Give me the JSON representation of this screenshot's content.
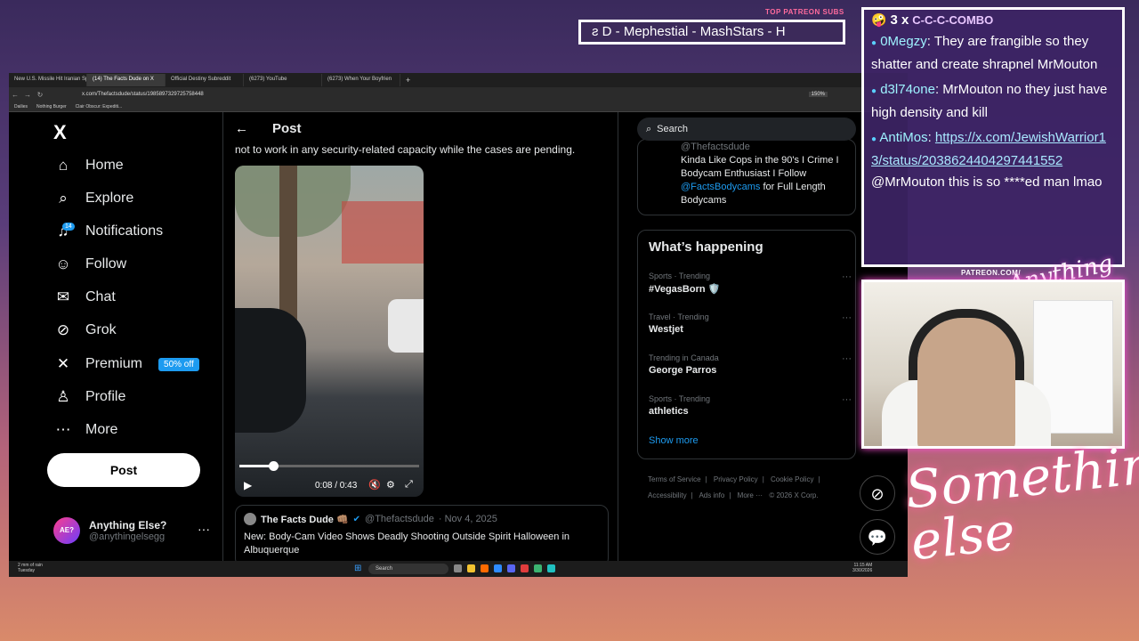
{
  "overlay": {
    "patreon_subs_title": "TOP PATREON SUBS",
    "ticker_text": "ƨ D - Mephestial - MashStars - H",
    "patreon_url": "PATREON.COM/",
    "logo_text": "Anything Else?",
    "signature_text": "Something else"
  },
  "browser": {
    "tabs": [
      {
        "label": "New U.S. Missile Hit Iranian Sp",
        "active": false
      },
      {
        "label": "(14) The Facts Dude on X",
        "active": true
      },
      {
        "label": "Official Destiny Subreddit",
        "active": false
      },
      {
        "label": "(6273) YouTube",
        "active": false
      },
      {
        "label": "(6273) When Your Boyfrien",
        "active": false
      }
    ],
    "url": "x.com/Thefactsdude/status/1985897329725758448",
    "zoom": "150%",
    "bookmarks": [
      "Dailies",
      "Nothing Burger",
      "Clair Obscur: Expediti..."
    ]
  },
  "x": {
    "logo": "X",
    "nav": [
      {
        "label": "Home",
        "icon": "home-icon"
      },
      {
        "label": "Explore",
        "icon": "search-icon"
      },
      {
        "label": "Notifications",
        "icon": "bell-icon",
        "badge": "14"
      },
      {
        "label": "Follow",
        "icon": "person-add-icon"
      },
      {
        "label": "Chat",
        "icon": "mail-icon"
      },
      {
        "label": "Grok",
        "icon": "grok-icon"
      },
      {
        "label": "Premium",
        "icon": "x-icon",
        "pill": "50% off"
      },
      {
        "label": "Profile",
        "icon": "person-icon"
      },
      {
        "label": "More",
        "icon": "more-circle-icon"
      }
    ],
    "post_button": "Post",
    "account": {
      "avatar_text": "AE?",
      "name": "Anything Else?",
      "handle": "@anythingelsegg"
    },
    "post_header": "Post",
    "body_text": "not to work in any security-related capacity while the cases are pending.",
    "video": {
      "time": "0:08 / 0:43",
      "progress": 0.186
    },
    "quote": {
      "name": "The Facts Dude 👊🏽",
      "handle": "@Thefactsdude",
      "date": "· Nov 4, 2025",
      "text": "New: Body-Cam Video Shows Deadly Shooting Outside Spirit Halloween in Albuquerque"
    },
    "search_label": "Search",
    "bio": {
      "handle": "@Thefactsdude",
      "text": "Kinda Like Cops in the 90's I Crime I Bodycam Enthusiast I Follow ",
      "link": "@FactsBodycams",
      "text_tail": " for Full Length Bodycams"
    },
    "happening": {
      "title": "What’s happening",
      "trends": [
        {
          "meta": "Sports · Trending",
          "name": "#VegasBorn 🛡️"
        },
        {
          "meta": "Travel · Trending",
          "name": "Westjet"
        },
        {
          "meta": "Trending in Canada",
          "name": "George Parros"
        },
        {
          "meta": "Sports · Trending",
          "name": "athletics"
        }
      ],
      "show_more": "Show more"
    },
    "footer": [
      "Terms of Service",
      "|",
      "Privacy Policy",
      "|",
      "Cookie Policy",
      "|",
      "Accessibility",
      "|",
      "Ads info",
      "|",
      "More ···",
      "© 2026 X Corp."
    ]
  },
  "taskbar": {
    "weather_line1": "2 mm of rain",
    "weather_line2": "Tuesday",
    "search": "Search",
    "time": "11:15 AM",
    "date": "3/30/2026"
  },
  "chat": {
    "combo_count": "3 x",
    "combo_text": "C-C-C-COMBO",
    "messages": [
      {
        "user": "0Megzy",
        "text": ": They are frangible so they shatter and create shrapnel MrMouton"
      },
      {
        "user": "d3l74one",
        "text": ": MrMouton no they just have high density and kill"
      },
      {
        "user": "AntiMos",
        "text": ":",
        "link": "https://x.com/JewishWarrior13/status/2038624404297441552",
        "after": " @MrMouton this is so ****ed man lmao"
      }
    ]
  },
  "colors": {
    "accent": "#1d9bf0",
    "overlay_border": "#ffffff",
    "chat_bg": "#3c2464"
  }
}
